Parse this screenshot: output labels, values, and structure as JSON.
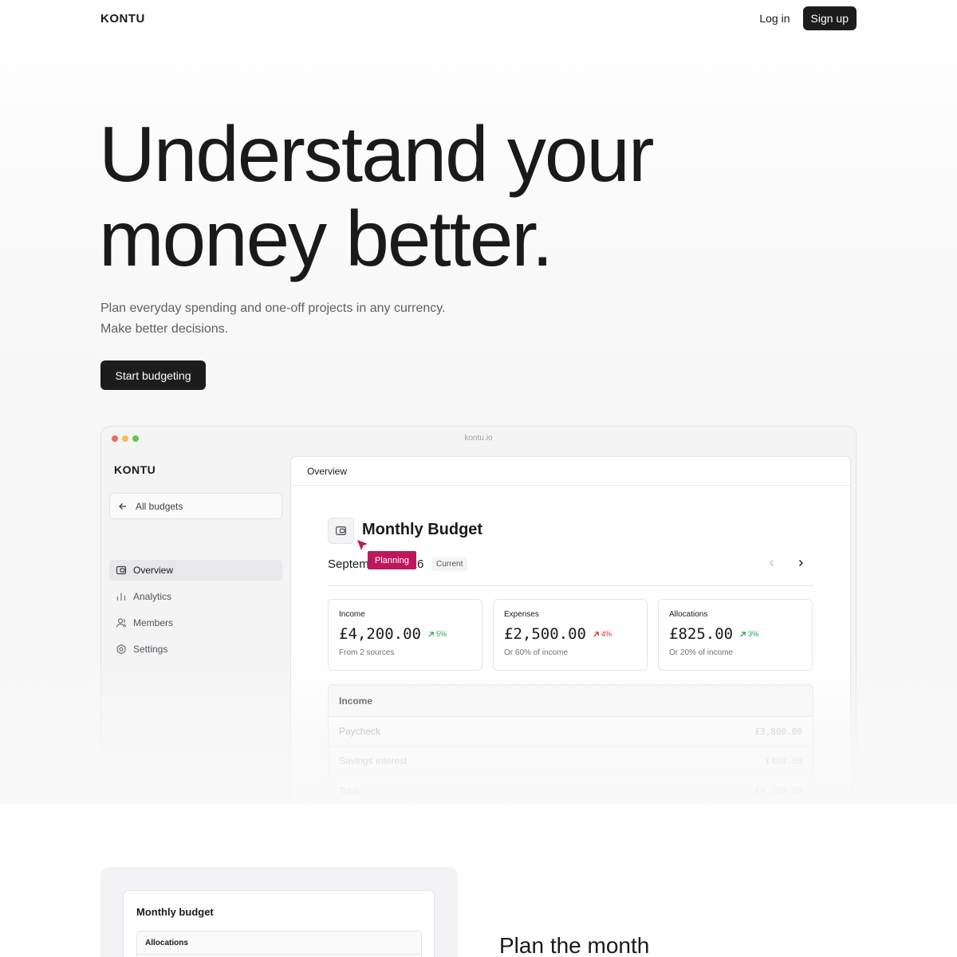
{
  "nav": {
    "logo": "KONTU",
    "login": "Log in",
    "signup": "Sign up"
  },
  "hero": {
    "title_line1": "Understand your",
    "title_line2": "money better.",
    "subtitle_line1": "Plan everyday spending and one-off projects in any currency.",
    "subtitle_line2": "Make better decisions.",
    "cta": "Start budgeting"
  },
  "window": {
    "url": "kontu.io",
    "dots": [
      "#ec6a5e",
      "#f4bf4f",
      "#61c554"
    ]
  },
  "sidebar": {
    "logo": "KONTU",
    "back": "All budgets",
    "items": [
      {
        "label": "Overview",
        "icon": "wallet-icon",
        "active": true
      },
      {
        "label": "Analytics",
        "icon": "bar-chart-icon",
        "active": false
      },
      {
        "label": "Members",
        "icon": "users-icon",
        "active": false
      },
      {
        "label": "Settings",
        "icon": "gear-icon",
        "active": false
      }
    ]
  },
  "main": {
    "header": "Overview",
    "budget_title": "Monthly Budget",
    "planning_tag": "Planning",
    "period_start": "Septem",
    "period_end": "26",
    "current_badge": "Current",
    "stats": [
      {
        "label": "Income",
        "value": "£4,200.00",
        "delta": "5%",
        "trend": "up",
        "color": "#16a34a",
        "note": "From 2 sources"
      },
      {
        "label": "Expenses",
        "value": "£2,500.00",
        "delta": "4%",
        "trend": "up",
        "color": "#dc2626",
        "note": "Or 60% of income"
      },
      {
        "label": "Allocations",
        "value": "£825.00",
        "delta": "3%",
        "trend": "up",
        "color": "#16a34a",
        "note": "Or 20% of income"
      }
    ],
    "income_table": {
      "title": "Income",
      "rows": [
        {
          "label": "Paycheck",
          "amount": "£3,800.00"
        },
        {
          "label": "Savings interest",
          "amount": "£400.00"
        },
        {
          "label": "Total",
          "amount": "£4,200.00"
        }
      ]
    }
  },
  "feature": {
    "card_title": "Monthly budget",
    "allocations_head": "Allocations",
    "heading": "Plan the month"
  },
  "colors": {
    "accent": "#be185d",
    "dark": "#1c1c1c"
  }
}
